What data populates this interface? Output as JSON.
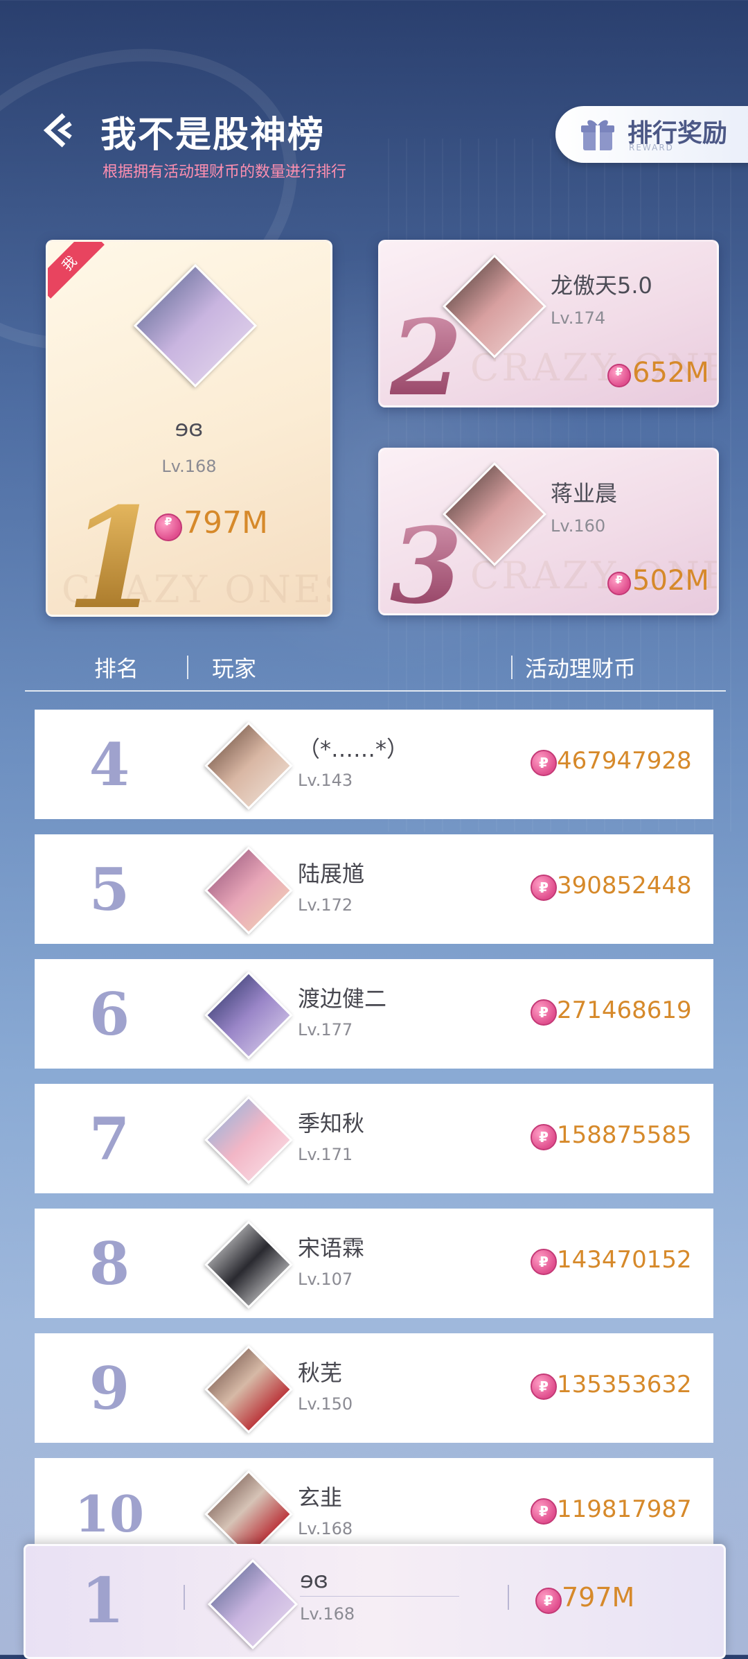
{
  "header": {
    "title": "我不是股神榜",
    "subtitle": "根据拥有活动理财币的数量进行排行",
    "reward_label": "排行奖励",
    "reward_sub": "REWARD"
  },
  "podium": [
    {
      "rank": "1",
      "name": "ɘɞ",
      "level": "Lv.168",
      "coins": "797M",
      "me_tag": "我",
      "watermark": "CRAZY ONES"
    },
    {
      "rank": "2",
      "name": "龙傲天5.0",
      "level": "Lv.174",
      "coins": "652M",
      "watermark": "CRAZY ONES"
    },
    {
      "rank": "3",
      "name": "蒋业晨",
      "level": "Lv.160",
      "coins": "502M",
      "watermark": "CRAZY ONES"
    }
  ],
  "table": {
    "col_rank": "排名",
    "col_player": "玩家",
    "col_coins": "活动理财币"
  },
  "rows": [
    {
      "rank": "4",
      "name": "（*……*）",
      "level": "Lv.143",
      "coins": "467947928"
    },
    {
      "rank": "5",
      "name": "陆展馗",
      "level": "Lv.172",
      "coins": "390852448"
    },
    {
      "rank": "6",
      "name": "渡边健二",
      "level": "Lv.177",
      "coins": "271468619"
    },
    {
      "rank": "7",
      "name": "季知秋",
      "level": "Lv.171",
      "coins": "158875585"
    },
    {
      "rank": "8",
      "name": "宋语霖",
      "level": "Lv.107",
      "coins": "143470152"
    },
    {
      "rank": "9",
      "name": "秋芜",
      "level": "Lv.150",
      "coins": "135353632"
    },
    {
      "rank": "10",
      "name": "玄韭",
      "level": "Lv.168",
      "coins": "119817987"
    }
  ],
  "self": {
    "rank": "1",
    "name": "ɘɞ",
    "level": "Lv.168",
    "coins": "797M"
  },
  "icons": {
    "back": "back-arrow-icon",
    "gift": "gift-icon",
    "coin": "coin-icon"
  },
  "colors": {
    "accent_coin": "#d6892a",
    "rank_number": "#9fa2cd",
    "me_tag": "#e8445f",
    "subtitle": "#ff8fb0"
  }
}
